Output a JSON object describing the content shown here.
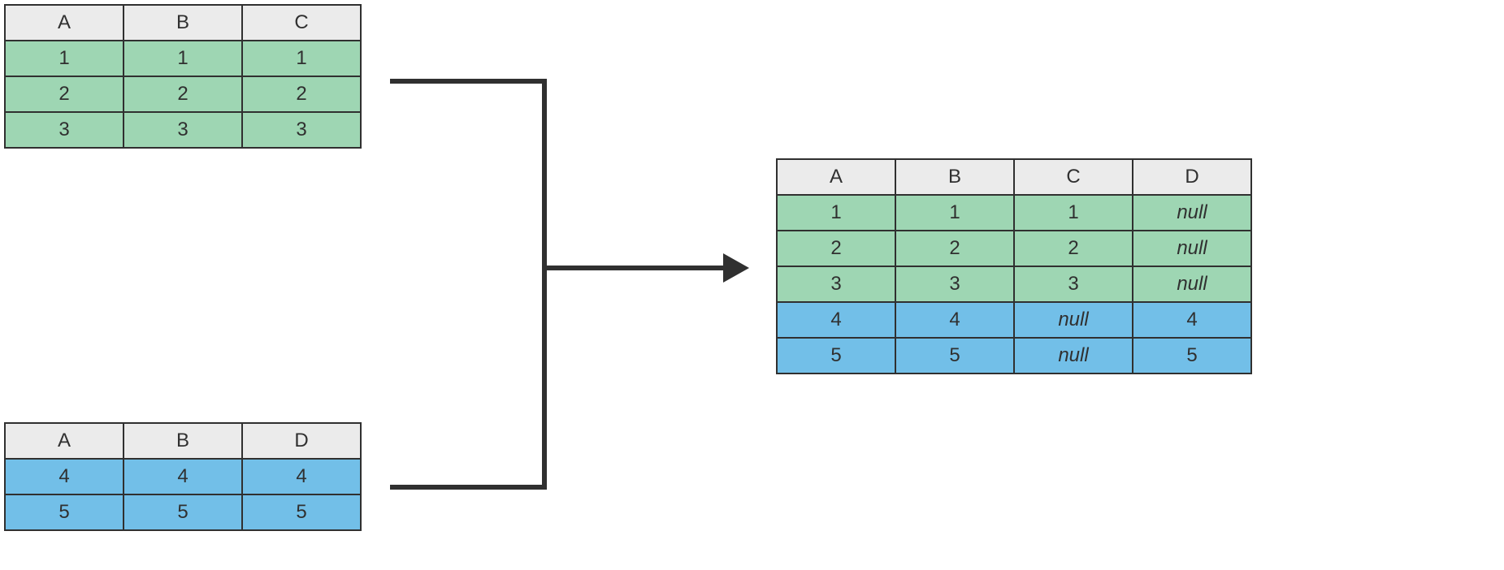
{
  "tables": {
    "top": {
      "headers": [
        "A",
        "B",
        "C"
      ],
      "rows": [
        {
          "A": "1",
          "B": "1",
          "C": "1"
        },
        {
          "A": "2",
          "B": "2",
          "C": "2"
        },
        {
          "A": "3",
          "B": "3",
          "C": "3"
        }
      ]
    },
    "bottom": {
      "headers": [
        "A",
        "B",
        "D"
      ],
      "rows": [
        {
          "A": "4",
          "B": "4",
          "D": "4"
        },
        {
          "A": "5",
          "B": "5",
          "D": "5"
        }
      ]
    },
    "result": {
      "headers": [
        "A",
        "B",
        "C",
        "D"
      ],
      "rows": [
        {
          "A": "1",
          "B": "1",
          "C": "1",
          "D": "null",
          "color": "green"
        },
        {
          "A": "2",
          "B": "2",
          "C": "2",
          "D": "null",
          "color": "green"
        },
        {
          "A": "3",
          "B": "3",
          "C": "3",
          "D": "null",
          "color": "green"
        },
        {
          "A": "4",
          "B": "4",
          "C": "null",
          "D": "4",
          "color": "blue"
        },
        {
          "A": "5",
          "B": "5",
          "C": "null",
          "D": "5",
          "color": "blue"
        }
      ]
    }
  },
  "null_label": "null",
  "colors": {
    "header_bg": "#ebebeb",
    "green_bg": "#9ed6b3",
    "blue_bg": "#72bfe8",
    "border": "#303030"
  }
}
